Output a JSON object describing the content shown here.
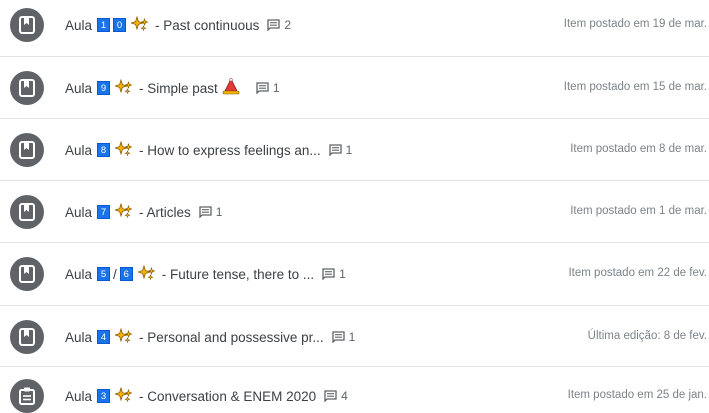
{
  "items": [
    {
      "prefix": "Aula",
      "nums": [
        "1",
        "0"
      ],
      "sep": "",
      "text": "- Past continuous",
      "hat": false,
      "comments": "2",
      "meta": "Item postado em 19 de mar.",
      "icon": "book-icon"
    },
    {
      "prefix": "Aula",
      "nums": [
        "9"
      ],
      "sep": "",
      "text": "- Simple past",
      "hat": true,
      "comments": "1",
      "meta": "Item postado em 15 de mar.",
      "icon": "book-icon"
    },
    {
      "prefix": "Aula",
      "nums": [
        "8"
      ],
      "sep": "",
      "text": "- How to express feelings an...",
      "hat": false,
      "comments": "1",
      "meta": "Item postado em 8 de mar.",
      "icon": "book-icon"
    },
    {
      "prefix": "Aula",
      "nums": [
        "7"
      ],
      "sep": "",
      "text": "- Articles",
      "hat": false,
      "comments": "1",
      "meta": "Item postado em 1 de mar.",
      "icon": "book-icon"
    },
    {
      "prefix": "Aula",
      "nums": [
        "5",
        "6"
      ],
      "sep": "/",
      "text": "- Future tense, there to ...",
      "hat": false,
      "comments": "1",
      "meta": "Item postado em 22 de fev.",
      "icon": "book-icon"
    },
    {
      "prefix": "Aula",
      "nums": [
        "4"
      ],
      "sep": "",
      "text": "- Personal and possessive pr...",
      "hat": false,
      "comments": "1",
      "meta": "Última edição: 8 de fev.",
      "icon": "book-icon"
    },
    {
      "prefix": "Aula",
      "nums": [
        "3"
      ],
      "sep": "",
      "text": "- Conversation & ENEM 2020",
      "hat": false,
      "comments": "4",
      "meta": "Item postado em 25 de jan.",
      "icon": "assignment-icon"
    }
  ],
  "colors": {
    "avatar": "#5f6368",
    "number_box": "#1a73e8",
    "text": "#3c4043",
    "meta": "#7d8287"
  }
}
